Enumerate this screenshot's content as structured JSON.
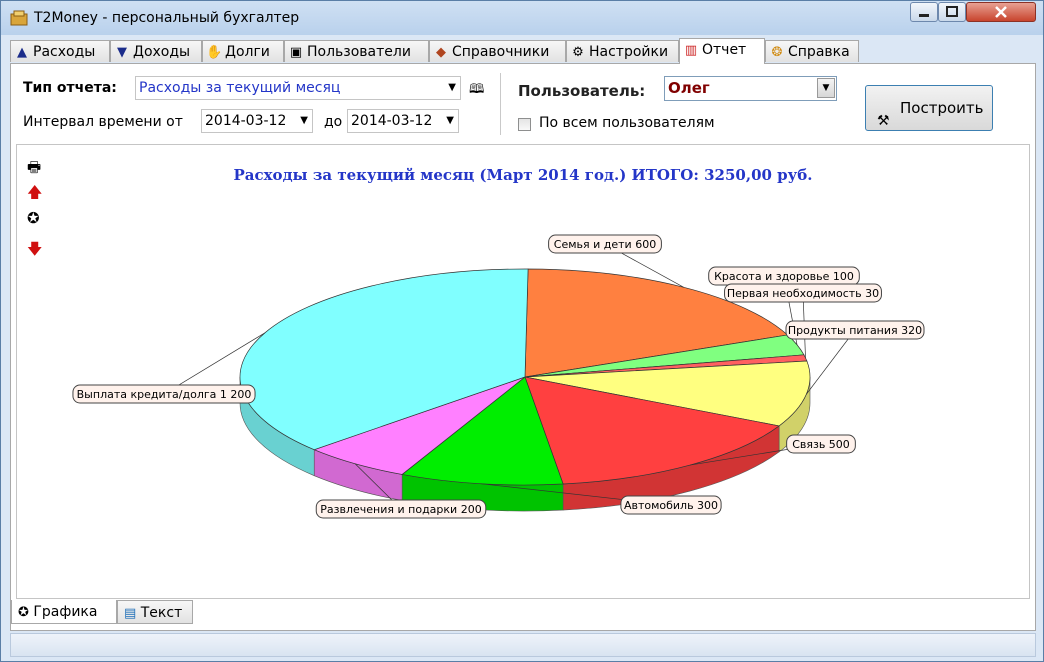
{
  "window": {
    "title": "T2Money - персональный бухгалтер"
  },
  "tabs": [
    {
      "label": "Расходы",
      "icon": "expense-arrow-icon"
    },
    {
      "label": "Доходы",
      "icon": "income-arrow-icon"
    },
    {
      "label": "Долги",
      "icon": "debts-icon"
    },
    {
      "label": "Пользователи",
      "icon": "users-icon"
    },
    {
      "label": "Справочники",
      "icon": "directories-icon"
    },
    {
      "label": "Настройки",
      "icon": "settings-icon"
    },
    {
      "label": "Отчет",
      "icon": "report-icon"
    },
    {
      "label": "Справка",
      "icon": "help-icon"
    }
  ],
  "active_tab": "Отчет",
  "report": {
    "type_label": "Тип отчета:",
    "type_value": "Расходы за текущий месяц",
    "interval_label": "Интервал времени от",
    "date_from": "2014-03-12",
    "to_label": "до",
    "date_to": "2014-03-12",
    "user_label": "Пользователь:",
    "user_value": "Олег",
    "all_users_label": "По всем пользователям",
    "all_users_checked": false,
    "build_button": "Построить"
  },
  "view_tabs": [
    {
      "label": "Графика",
      "icon": "chart-icon",
      "active": true
    },
    {
      "label": "Текст",
      "icon": "text-doc-icon",
      "active": false
    }
  ],
  "chart_data": {
    "type": "pie",
    "title": "Расходы за текущий месяц (Март 2014 год.) ИТОГО: 3250,00 руб.",
    "slices": [
      {
        "label": "Семья и дети",
        "value": 600,
        "color": "#ff8040"
      },
      {
        "label": "Красота и здоровье",
        "value": 100,
        "color": "#80ff80"
      },
      {
        "label": "Первая необходимость",
        "value": 30,
        "color": "#ff6060"
      },
      {
        "label": "Продукты питания",
        "value": 320,
        "color": "#ffff80"
      },
      {
        "label": "Связь",
        "value": 500,
        "color": "#ff4040"
      },
      {
        "label": "Автомобиль",
        "value": 300,
        "color": "#00ee00"
      },
      {
        "label": "Развлечения и подарки",
        "value": 200,
        "color": "#ff80ff"
      },
      {
        "label": "Выплата кредита/долга",
        "value": 1200,
        "color": "#80ffff"
      }
    ],
    "data_labels": [
      "Семья и дети 600",
      "Красота и здоровье 100",
      "Первая необходимость 30",
      "Продукты питания 320",
      "Связь 500",
      "Автомобиль 300",
      "Развлечения и подарки 200",
      "Выплата кредита/долга 1 200"
    ],
    "total": 3250
  }
}
